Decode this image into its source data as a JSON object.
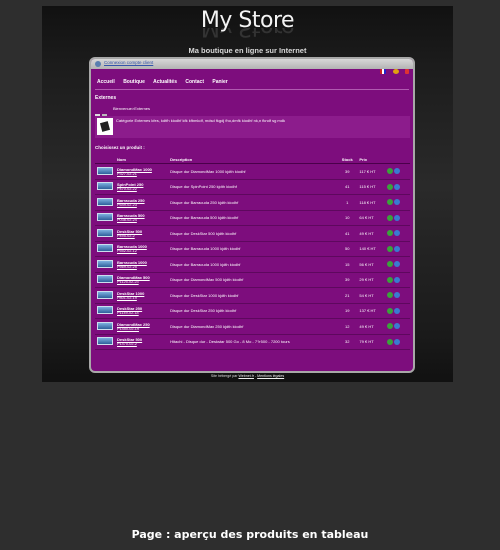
{
  "store": {
    "title": "My Store",
    "tagline": "Ma boutique en ligne sur Internet",
    "login_link": "Connexion compte client",
    "nav": [
      "Accueil",
      "Boutique",
      "Actualités",
      "Contact",
      "Panier"
    ],
    "section_title": "Externes",
    "breadcrumb": "Bienvenue>Externes",
    "category_desc": "Catégorie Externes kfes, kdtfh kiodhf kfk kfbmkdf, mdsd fkgdj fho,dmfk kiodhf nk,n fkndf sg mdk",
    "choose_label": "Choisissez un produit :",
    "columns": [
      "Nom",
      "Description",
      "Stock",
      "Prix"
    ],
    "products": [
      {
        "name": "DiamondMax 1000",
        "code": "P327-02-21",
        "desc": "Disque dur DiamondMax 1000 kjdth kiodhf",
        "stock": "39",
        "price": "117 €  HT"
      },
      {
        "name": "SpinPoint 250",
        "code": "P470-02-22",
        "desc": "Disque dur SpinPoint 250 kjdth kiodhf",
        "stock": "41",
        "price": "115 €  HT"
      },
      {
        "name": "Barracuda 250",
        "code": "P549-02-23",
        "desc": "Disque dur Barracuda 250 kjdth kiodhf",
        "stock": "1",
        "price": "118 €  HT"
      },
      {
        "name": "Barracuda 500",
        "code": "P038-02-24",
        "desc": "Disque dur Barracuda 500 kjdth kiodhf",
        "stock": "10",
        "price": "64 €  HT"
      },
      {
        "name": "DeskStar 500",
        "code": "P495-02-2",
        "desc": "Disque dur DeskStar 500 kjdth kiodhf",
        "stock": "41",
        "price": "49 €  HT"
      },
      {
        "name": "Barracuda 1000",
        "code": "P552-02-12",
        "desc": "Disque dur Barracuda 1000 kjdth kiodhf",
        "stock": "50",
        "price": "140 €  HT"
      },
      {
        "name": "Barracuda 1000",
        "code": "P569-02-25",
        "desc": "Disque dur Barracuda 1000 kjdth kiodhf",
        "stock": "15",
        "price": "56 €  HT"
      },
      {
        "name": "DiamondMax 500",
        "code": "P1125-02-23",
        "desc": "Disque dur DiamondMax 500 kjdth kiodhf",
        "stock": "39",
        "price": "29 €  HT"
      },
      {
        "name": "DeskStar 1000",
        "code": "P801-02-19",
        "desc": "Disque dur DeskStar 1000 kjdth kiodhf",
        "stock": "21",
        "price": "54 €  HT"
      },
      {
        "name": "DeskStar 250",
        "code": "P1149-02-18",
        "desc": "Disque dur DeskStar 250 kjdth kiodhf",
        "stock": "19",
        "price": "137 €  HT"
      },
      {
        "name": "DiamondMax 250",
        "code": "P1450-02-19",
        "desc": "Disque dur DiamondMax 250 kjdth kiodhf",
        "stock": "12",
        "price": "49 €  HT"
      },
      {
        "name": "DeskStar 500",
        "code": "P1470-02-2",
        "desc": "Hitachi - Disque dur - Deskstar 500 Go - 8 Mo - 7?r500 - 7200 tours",
        "stock": "32",
        "price": "79 €  HT"
      }
    ],
    "footer_text": "Site hébergé par",
    "footer_link1": "Webnet.fr",
    "footer_link2": "Mentions légales"
  },
  "caption": "Page : aperçu des produits en tableau",
  "colors": {
    "page_bg": "#2e2e2e",
    "frame_bg": "#7d0d7d",
    "accent_green": "#3aa33a",
    "accent_blue": "#3a7ad0"
  },
  "icons": [
    "user-icon",
    "flag-icon",
    "list-view-icon",
    "grid-view-icon",
    "add-to-cart-icon",
    "details-icon"
  ]
}
